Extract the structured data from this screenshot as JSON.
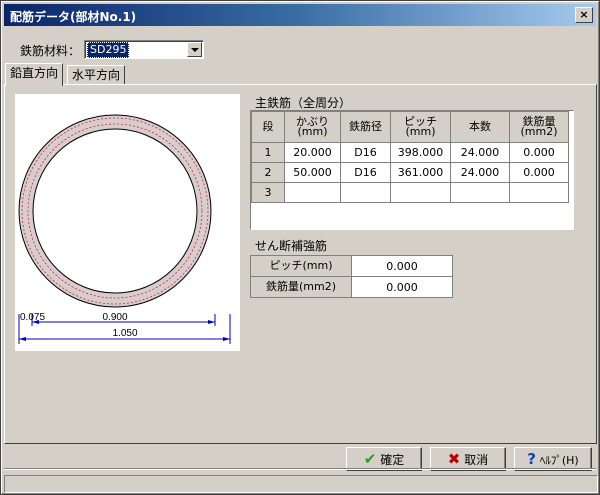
{
  "window": {
    "title": "配筋データ(部材No.1)",
    "close_label": "×"
  },
  "material": {
    "label": "鉄筋材料：",
    "value": "SD295"
  },
  "tabs": [
    {
      "label": "鉛直方向"
    },
    {
      "label": "水平方向"
    }
  ],
  "drawing": {
    "dim_cover": "0.075",
    "dim_inner": "0.900",
    "dim_outer": "1.050"
  },
  "main_rebar": {
    "title": "主鉄筋（全周分）",
    "headers": {
      "dan": "段",
      "cover_1": "かぶり",
      "cover_2": "(mm)",
      "diameter": "鉄筋径",
      "pitch_1": "ピッチ",
      "pitch_2": "(mm)",
      "count": "本数",
      "area_1": "鉄筋量",
      "area_2": "(mm2)"
    },
    "rows": [
      {
        "dan": "1",
        "cover": "20.000",
        "diameter": "D16",
        "pitch": "398.000",
        "count": "24.000",
        "area": "0.000"
      },
      {
        "dan": "2",
        "cover": "50.000",
        "diameter": "D16",
        "pitch": "361.000",
        "count": "24.000",
        "area": "0.000"
      },
      {
        "dan": "3",
        "cover": "",
        "diameter": "",
        "pitch": "",
        "count": "",
        "area": ""
      }
    ]
  },
  "shear": {
    "title": "せん断補強筋",
    "pitch_label": "ピッチ(mm)",
    "pitch_value": "0.000",
    "area_label": "鉄筋量(mm2)",
    "area_value": "0.000"
  },
  "buttons": {
    "ok": "確定",
    "cancel": "取消",
    "help": "ﾍﾙﾌﾟ(H)"
  },
  "colors": {
    "titlebar_start": "#0a246a",
    "ok_icon": "#2a9a1a",
    "cancel_icon": "#c00000",
    "help_icon": "#1040c0",
    "ring_fill": "#d8cccc",
    "dim_line": "#0000c0"
  }
}
